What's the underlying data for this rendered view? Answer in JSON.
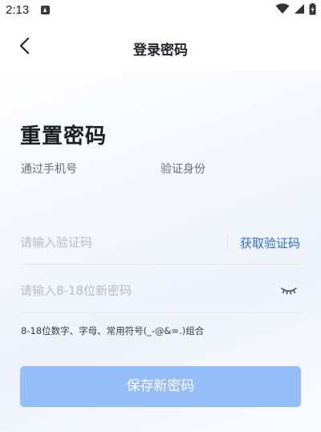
{
  "status_bar": {
    "time": "2:13",
    "icons": [
      "app-notification-icon",
      "wifi-icon",
      "signal-icon",
      "battery-icon"
    ]
  },
  "nav": {
    "title": "登录密码",
    "back_icon": "chevron-left-icon"
  },
  "page": {
    "heading": "重置密码",
    "subtitle_left": "通过手机号",
    "subtitle_right": "验证身份"
  },
  "form": {
    "code_placeholder": "请输入验证码",
    "get_code_label": "获取验证码",
    "password_placeholder": "请输入8-18位新密码",
    "password_toggle_icon": "eye-closed-icon",
    "hint": "8-18位数字、字母、常用符号(_-@&=.)组合",
    "submit_label": "保存新密码"
  },
  "colors": {
    "accent": "#2f6be0",
    "button_disabled": "#95bdf8",
    "heading": "#1a1d22",
    "placeholder": "#b8bcc3"
  }
}
